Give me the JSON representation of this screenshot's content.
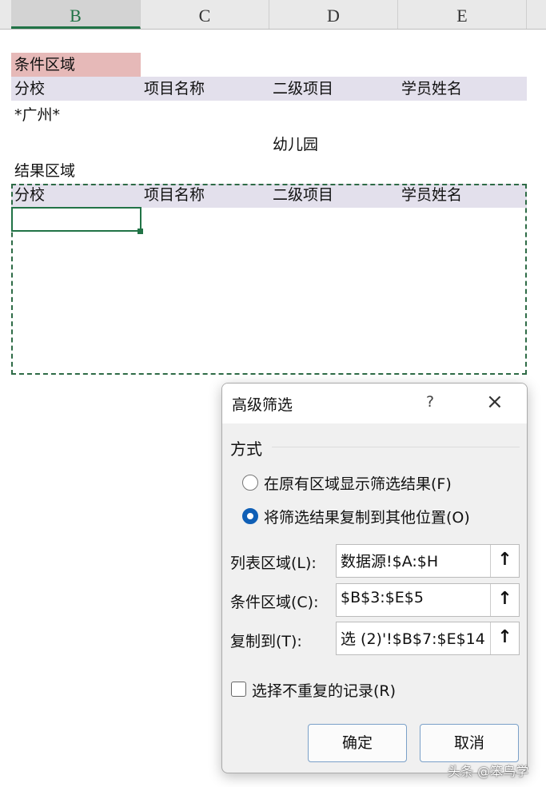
{
  "columns": [
    "B",
    "C",
    "D",
    "E"
  ],
  "sheet": {
    "criteria_title": "条件区域",
    "headers": [
      "分校",
      "项目名称",
      "二级项目",
      "学员姓名"
    ],
    "criteria_row1_b": "*广州*",
    "criteria_row2_d": "幼儿园",
    "result_title": "结果区域"
  },
  "dialog": {
    "title": "高级筛选",
    "help": "?",
    "close": "×",
    "section": "方式",
    "radio1": "在原有区域显示筛选结果(F)",
    "radio2": "将筛选结果复制到其他位置(O)",
    "list_label": "列表区域(L):",
    "list_value": "数据源!$A:$H",
    "criteria_label": "条件区域(C):",
    "criteria_value": "$B$3:$E$5",
    "copy_label": "复制到(T):",
    "copy_value": "选 (2)'!$B$7:$E$14",
    "unique_label": "选择不重复的记录(R)",
    "ok": "确定",
    "cancel": "取消",
    "collapse_icon": "↑"
  },
  "watermark": "头条 @笨鸟学"
}
